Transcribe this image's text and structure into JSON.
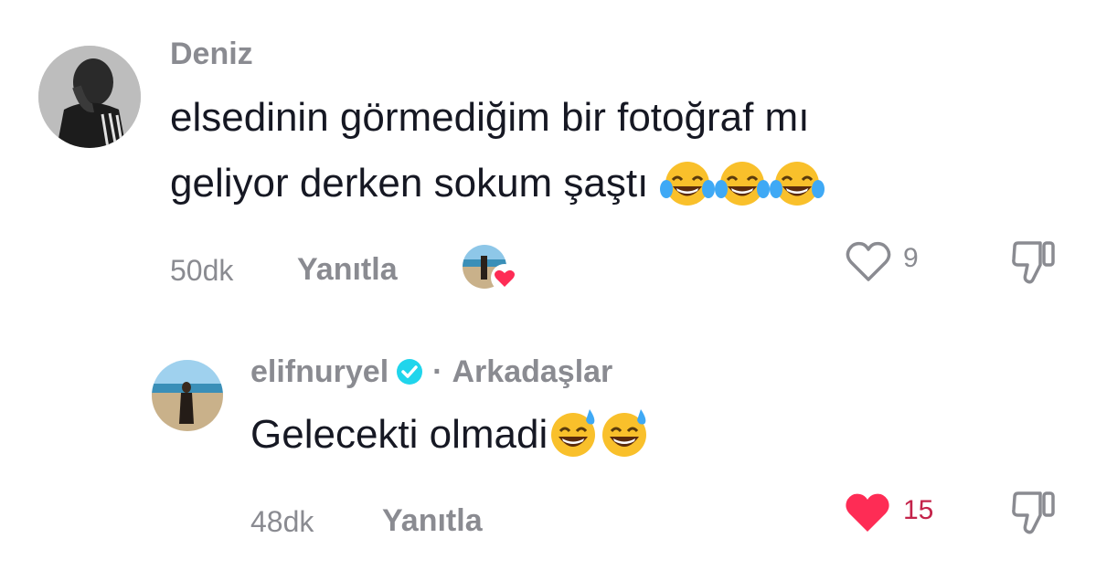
{
  "comments": [
    {
      "username": "Deniz",
      "line1": "elsedinin görmediğim bir fotoğraf mı",
      "line2": "geliyor derken sokum şaştı",
      "time": "50dk",
      "reply_label": "Yanıtla",
      "like_count": "9",
      "liked_by_creator": true
    },
    {
      "username": "elifnuryel",
      "verified": true,
      "relation": "Arkadaşlar",
      "text": "Gelecekti olmadi",
      "time": "48dk",
      "reply_label": "Yanıtla",
      "like_count": "15",
      "liked": true
    }
  ],
  "colors": {
    "muted": "#8a8b91",
    "like_red": "#fe2c55",
    "like_count_red": "#c4234a",
    "verified_blue": "#20d5ec"
  },
  "icons": {
    "like_outline": "heart-outline-icon",
    "like_filled": "heart-filled-icon",
    "dislike": "thumbs-down-icon",
    "verified": "verified-badge-icon",
    "emoji_laugh": "face-with-tears-of-joy-icon",
    "emoji_sweat": "grinning-face-with-sweat-icon"
  }
}
